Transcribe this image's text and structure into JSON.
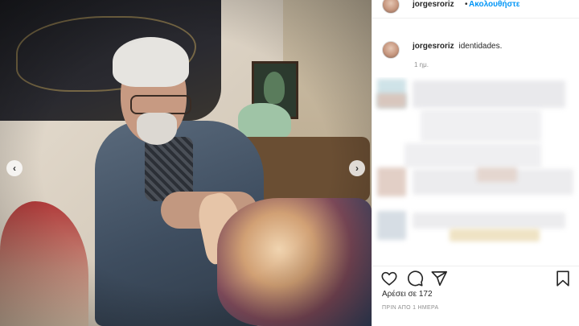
{
  "post": {
    "username": "jorgesroriz",
    "separator": "•",
    "follow_label": "Ακολουθήστε",
    "caption_username": "jorgesroriz",
    "caption_text": "identidades.",
    "caption_time": "1 ημ.",
    "likes_label": "Αρέσει σε 172",
    "timestamp": "ΠΡΙΝ ΑΠΟ 1 ΗΜΕΡΑ"
  },
  "photo": {
    "prev_arrow": "‹",
    "next_arrow": "›"
  },
  "icons": {
    "like": "heart-icon",
    "comment": "comment-icon",
    "share": "share-icon",
    "save": "bookmark-icon",
    "prev": "chevron-left-icon",
    "next": "chevron-right-icon"
  },
  "colors": {
    "follow": "#0095f6",
    "text": "#262626",
    "muted": "#8e8e8e"
  }
}
